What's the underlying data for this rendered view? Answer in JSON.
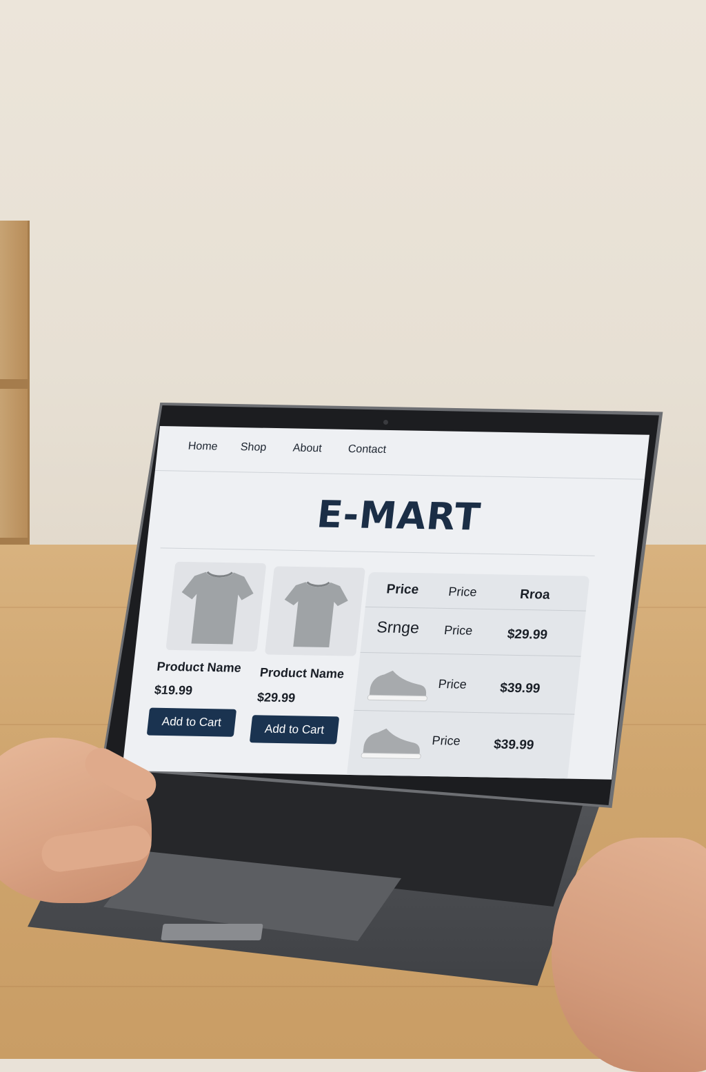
{
  "nav": {
    "items": [
      "Home",
      "Shop",
      "About",
      "Contact"
    ]
  },
  "brand": {
    "title": "E-MART"
  },
  "products": [
    {
      "name": "Product Name",
      "price": "$19.99",
      "button": "Add to Cart"
    },
    {
      "name": "Product Name",
      "price": "$29.99",
      "button": "Add to Cart"
    }
  ],
  "price_table": {
    "headers": [
      "Price",
      "Price",
      "Rroa"
    ],
    "rows": [
      {
        "label": "Srnge",
        "col2": "Price",
        "price": "$29.99"
      },
      {
        "label": "",
        "col2": "Price",
        "price": "$39.99"
      },
      {
        "label": "",
        "col2": "Price",
        "price": "$39.99"
      }
    ]
  },
  "colors": {
    "brand_text": "#1b2e46",
    "button_bg": "#1a3350",
    "screen_bg": "#eef0f3"
  },
  "icons": [
    "tshirt-icon",
    "tshirt-icon",
    "sneaker-icon",
    "sneaker-icon"
  ]
}
